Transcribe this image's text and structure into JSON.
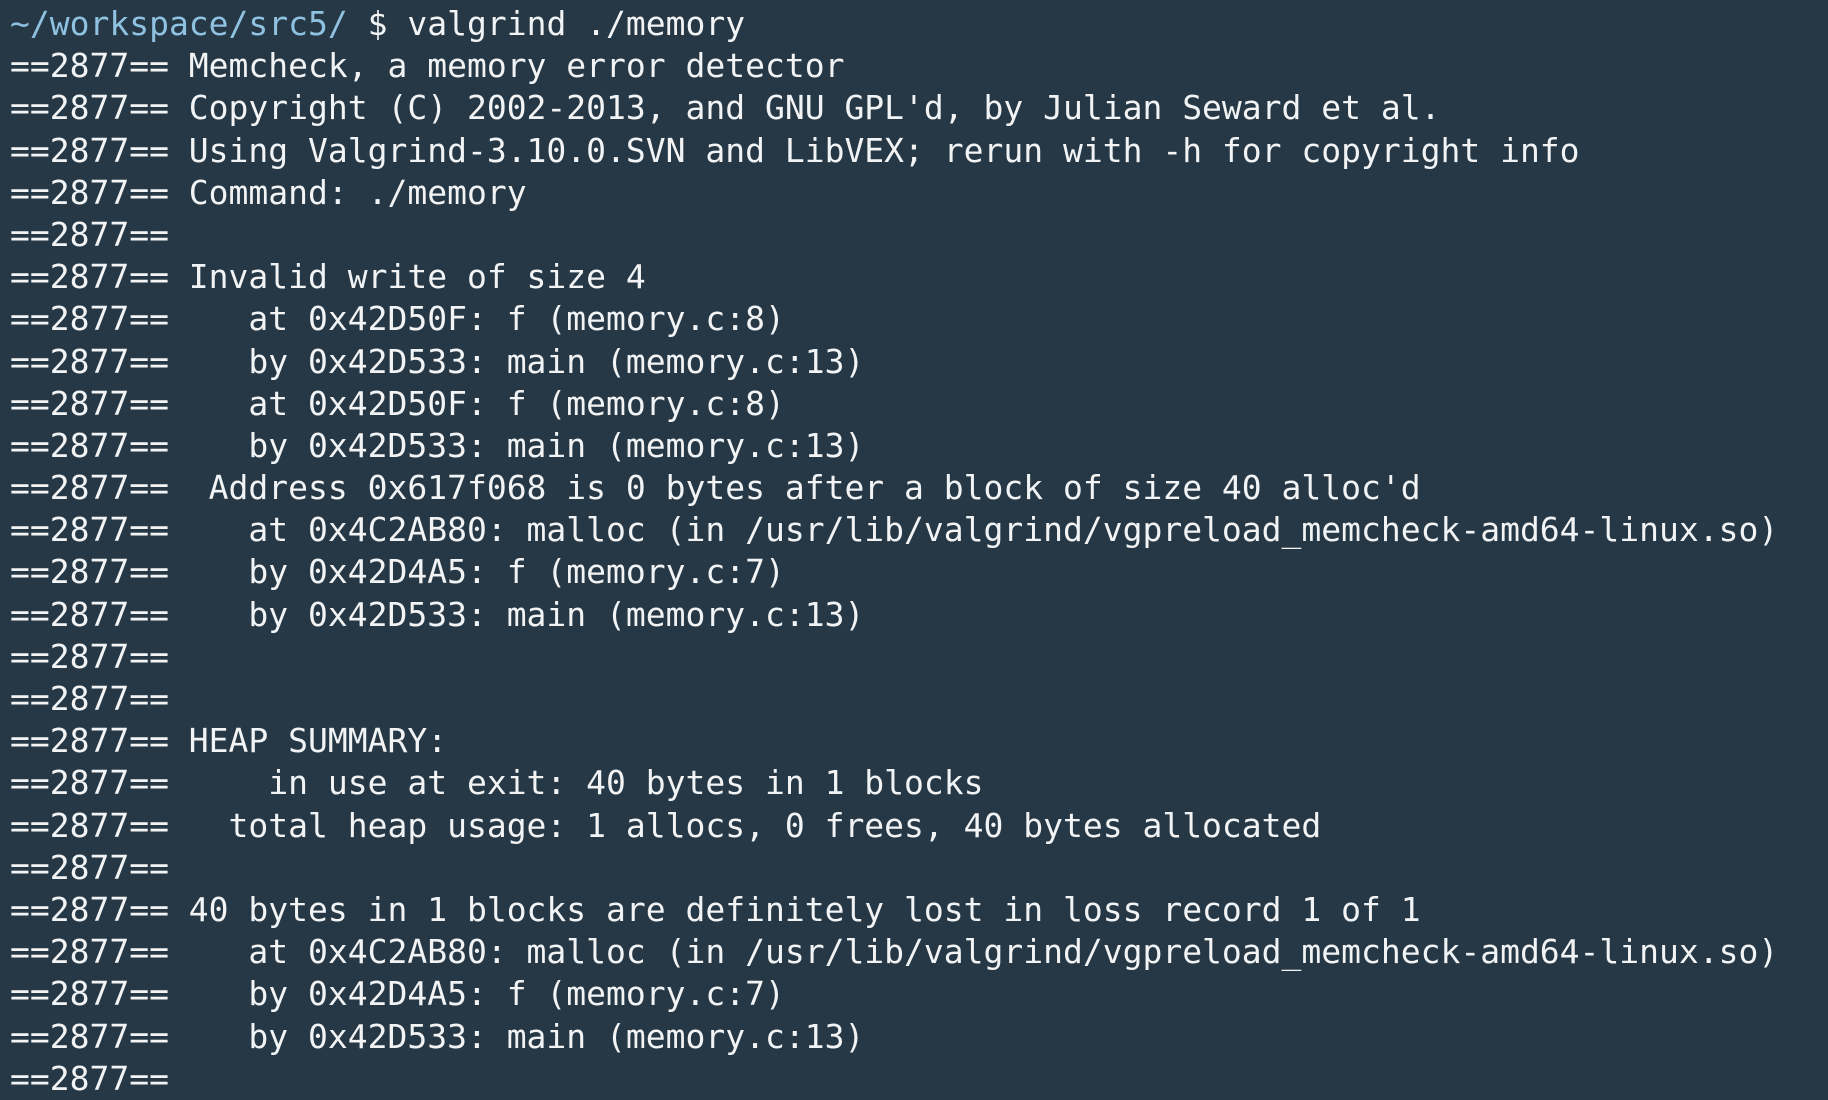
{
  "colors": {
    "background": "#263845",
    "text": "#f1f3f4",
    "prompt_path": "#8fc1e0"
  },
  "prompt": {
    "path": "~/workspace/src5/",
    "command": " $ valgrind ./memory"
  },
  "output_lines": [
    "==2877== Memcheck, a memory error detector",
    "==2877== Copyright (C) 2002-2013, and GNU GPL'd, by Julian Seward et al.",
    "==2877== Using Valgrind-3.10.0.SVN and LibVEX; rerun with -h for copyright info",
    "==2877== Command: ./memory",
    "==2877==",
    "==2877== Invalid write of size 4",
    "==2877==    at 0x42D50F: f (memory.c:8)",
    "==2877==    by 0x42D533: main (memory.c:13)",
    "==2877==    at 0x42D50F: f (memory.c:8)",
    "==2877==    by 0x42D533: main (memory.c:13)",
    "==2877==  Address 0x617f068 is 0 bytes after a block of size 40 alloc'd",
    "==2877==    at 0x4C2AB80: malloc (in /usr/lib/valgrind/vgpreload_memcheck-amd64-linux.so)",
    "==2877==    by 0x42D4A5: f (memory.c:7)",
    "==2877==    by 0x42D533: main (memory.c:13)",
    "==2877==",
    "==2877==",
    "==2877== HEAP SUMMARY:",
    "==2877==     in use at exit: 40 bytes in 1 blocks",
    "==2877==   total heap usage: 1 allocs, 0 frees, 40 bytes allocated",
    "==2877==",
    "==2877== 40 bytes in 1 blocks are definitely lost in loss record 1 of 1",
    "==2877==    at 0x4C2AB80: malloc (in /usr/lib/valgrind/vgpreload_memcheck-amd64-linux.so)",
    "==2877==    by 0x42D4A5: f (memory.c:7)",
    "==2877==    by 0x42D533: main (memory.c:13)",
    "==2877=="
  ]
}
